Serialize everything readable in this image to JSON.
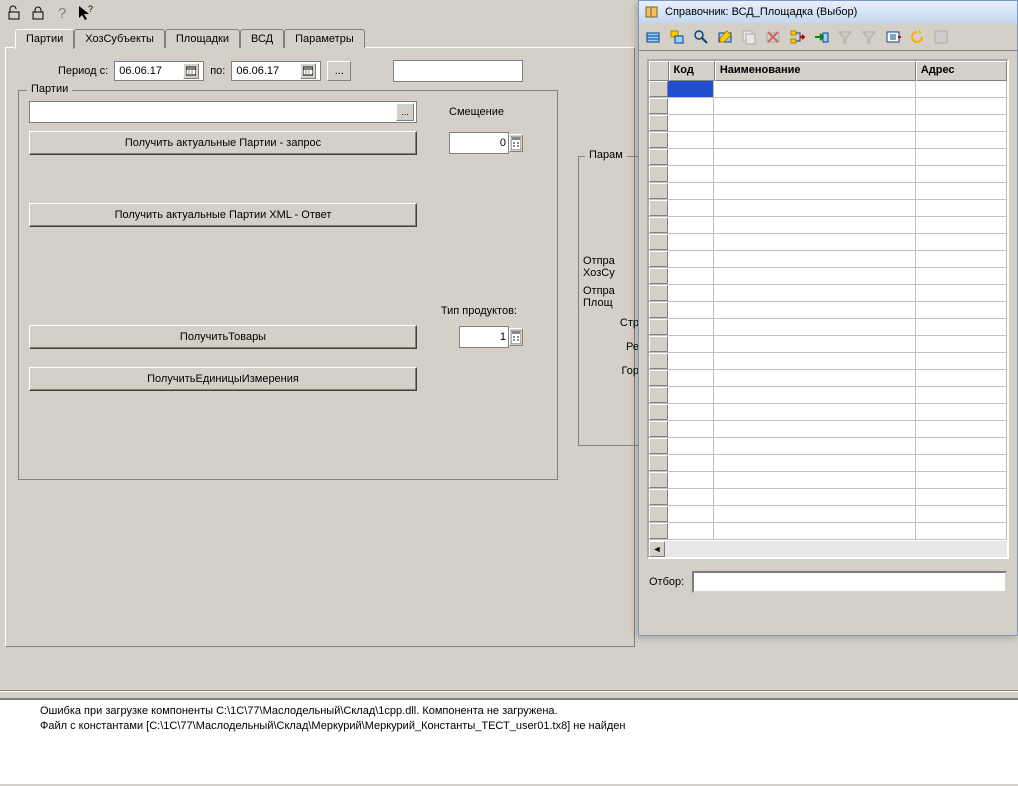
{
  "toolbar": {},
  "tabs": {
    "t0": "Партии",
    "t1": "ХозСубъекты",
    "t2": "Площадки",
    "t3": "ВСД",
    "t4": "Параметры"
  },
  "period": {
    "label_from": "Период с:",
    "date_from": "06.06.17",
    "label_to": "по:",
    "date_to": "06.06.17",
    "ellipsis": "..."
  },
  "parties": {
    "legend": "Партии",
    "ellipsis": "...",
    "btn_request": "Получить актуальные Партии - запрос",
    "btn_response": "Получить актуальные Партии XML - Ответ",
    "offset_label": "Смещение",
    "offset_value": "0",
    "product_type_label": "Тип продуктов:",
    "product_type_value": "1",
    "btn_goods": "ПолучитьТовары",
    "btn_units": "ПолучитьЕдиницыИзмерения"
  },
  "params": {
    "legend": "Парам",
    "l_sender1": "Отпра",
    "l_sender2": "ХозСу",
    "l_sender3": "Отпра",
    "l_sender4": "Площ",
    "l_country": "Стр",
    "l_region": "Ре",
    "l_city": "Гор"
  },
  "dialog": {
    "title": "Справочник: ВСД_Площадка (Выбор)",
    "columns": {
      "code": "Код",
      "name": "Наименование",
      "addr": "Адрес"
    },
    "filter_label": "Отбор:"
  },
  "messages": {
    "line1": "Ошибка при загрузке компоненты C:\\1C\\77\\Маслодельный\\Склад\\1cpp.dll. Компонента не загружена.",
    "line2": "Файл с константами [C:\\1C\\77\\Маслодельный\\Склад\\Меркурий\\Меркурий_Константы_ТЕСТ_user01.tx8] не найден"
  }
}
